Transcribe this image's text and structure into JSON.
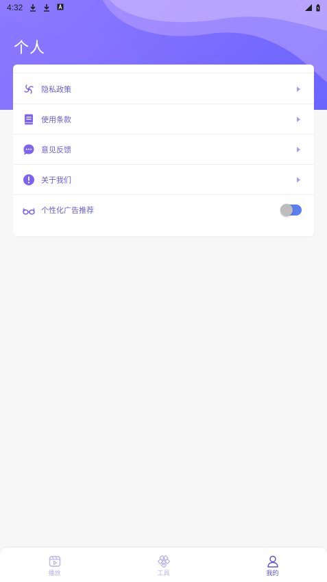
{
  "status_bar": {
    "time": "4:32"
  },
  "page": {
    "title": "个人"
  },
  "menu": {
    "items": [
      {
        "label": "隐私政策",
        "icon": "swirl-icon"
      },
      {
        "label": "使用条款",
        "icon": "book-icon"
      },
      {
        "label": "意见反馈",
        "icon": "chat-bubble-icon"
      },
      {
        "label": "关于我们",
        "icon": "info-exclamation-icon"
      }
    ],
    "personalized_ads": {
      "label": "个性化广告推荐",
      "icon": "glasses-icon",
      "enabled": true
    }
  },
  "bottom_nav": {
    "items": [
      {
        "label": "播放",
        "icon": "play-icon"
      },
      {
        "label": "工具",
        "icon": "tools-icon"
      },
      {
        "label": "我的",
        "icon": "profile-icon"
      }
    ],
    "active_index": 2
  },
  "colors": {
    "accent": "#6a5ed8",
    "header_purple": "#7b6dff",
    "toggle_on": "#5a7ef0",
    "nav_inactive": "#b8b3ea"
  }
}
